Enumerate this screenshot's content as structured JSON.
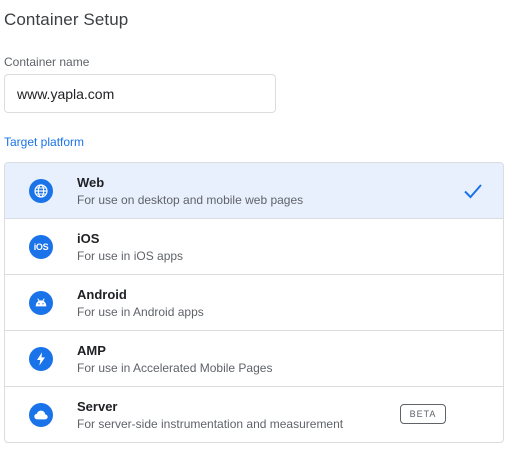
{
  "page": {
    "title": "Container Setup"
  },
  "container_name": {
    "label": "Container name",
    "value": "www.yapla.com"
  },
  "target_platform": {
    "label": "Target platform",
    "selected": "web",
    "items": [
      {
        "id": "web",
        "title": "Web",
        "description": "For use on desktop and mobile web pages",
        "icon": "globe-icon"
      },
      {
        "id": "ios",
        "title": "iOS",
        "description": "For use in iOS apps",
        "icon": "ios-icon",
        "icon_text": "iOS"
      },
      {
        "id": "android",
        "title": "Android",
        "description": "For use in Android apps",
        "icon": "android-icon"
      },
      {
        "id": "amp",
        "title": "AMP",
        "description": "For use in Accelerated Mobile Pages",
        "icon": "lightning-bolt-icon"
      },
      {
        "id": "server",
        "title": "Server",
        "description": "For server-side instrumentation and measurement",
        "icon": "cloud-icon",
        "badge": "BETA"
      }
    ]
  },
  "colors": {
    "accent": "#1a73e8",
    "selected_bg": "#e8f0fe",
    "border": "#dadce0",
    "text_primary": "#202124",
    "text_secondary": "#5f6368"
  }
}
